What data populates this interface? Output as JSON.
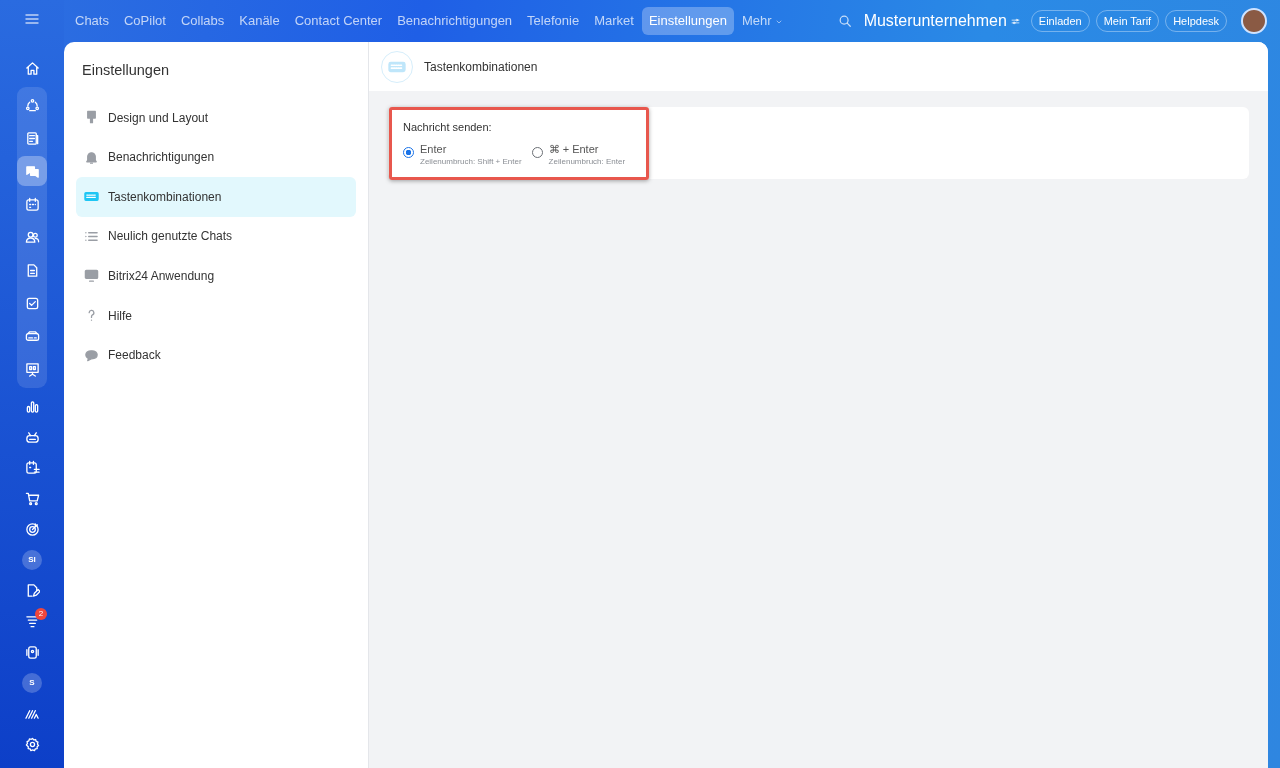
{
  "top_nav": {
    "items": [
      {
        "label": "Chats",
        "selected": false
      },
      {
        "label": "CoPilot",
        "selected": false
      },
      {
        "label": "Collabs",
        "selected": false
      },
      {
        "label": "Kanäle",
        "selected": false
      },
      {
        "label": "Contact Center",
        "selected": false
      },
      {
        "label": "Benachrichtigungen",
        "selected": false
      },
      {
        "label": "Telefonie",
        "selected": false
      },
      {
        "label": "Market",
        "selected": false
      },
      {
        "label": "Einstellungen",
        "selected": true
      }
    ],
    "more": "Mehr",
    "company": "Musterunternehmen",
    "buttons": [
      "Einladen",
      "Mein Tarif",
      "Helpdesk"
    ]
  },
  "rail": {
    "items": [
      {
        "kind": "icon",
        "selected": false
      },
      {
        "kind": "icon",
        "selected": false
      },
      {
        "kind": "icon",
        "selected": false
      },
      {
        "kind": "icon",
        "selected": true
      },
      {
        "kind": "icon",
        "selected": false
      },
      {
        "kind": "icon",
        "selected": false
      },
      {
        "kind": "icon",
        "selected": false
      },
      {
        "kind": "icon",
        "selected": false
      },
      {
        "kind": "icon",
        "selected": false
      },
      {
        "kind": "icon",
        "selected": false
      },
      {
        "kind": "icon",
        "selected": false
      },
      {
        "kind": "icon",
        "selected": false
      },
      {
        "kind": "icon",
        "selected": false
      },
      {
        "kind": "icon",
        "selected": false
      },
      {
        "kind": "icon",
        "selected": false
      },
      {
        "kind": "avatar",
        "label": "SI",
        "selected": false
      },
      {
        "kind": "icon",
        "selected": false
      },
      {
        "kind": "icon",
        "selected": false,
        "badge": "2"
      },
      {
        "kind": "icon",
        "selected": false
      },
      {
        "kind": "avatar",
        "label": "S",
        "selected": false
      },
      {
        "kind": "icon",
        "selected": false
      },
      {
        "kind": "icon",
        "selected": false
      }
    ]
  },
  "sidebar": {
    "title": "Einstellungen",
    "items": [
      {
        "label": "Design und Layout",
        "selected": false
      },
      {
        "label": "Benachrichtigungen",
        "selected": false
      },
      {
        "label": "Tastenkombinationen",
        "selected": true
      },
      {
        "label": "Neulich genutzte Chats",
        "selected": false
      },
      {
        "label": "Bitrix24 Anwendung",
        "selected": false
      },
      {
        "label": "Hilfe",
        "selected": false
      },
      {
        "label": "Feedback",
        "selected": false
      }
    ]
  },
  "content": {
    "title": "Tastenkombinationen",
    "group": {
      "label": "Nachricht senden:",
      "highlighted": true,
      "options": [
        {
          "label": "Enter",
          "hint": "Zeilenumbruch: Shift + Enter",
          "selected": true
        },
        {
          "label": "⌘ + Enter",
          "hint": "Zeilenumbruch: Enter",
          "selected": false
        }
      ]
    }
  }
}
